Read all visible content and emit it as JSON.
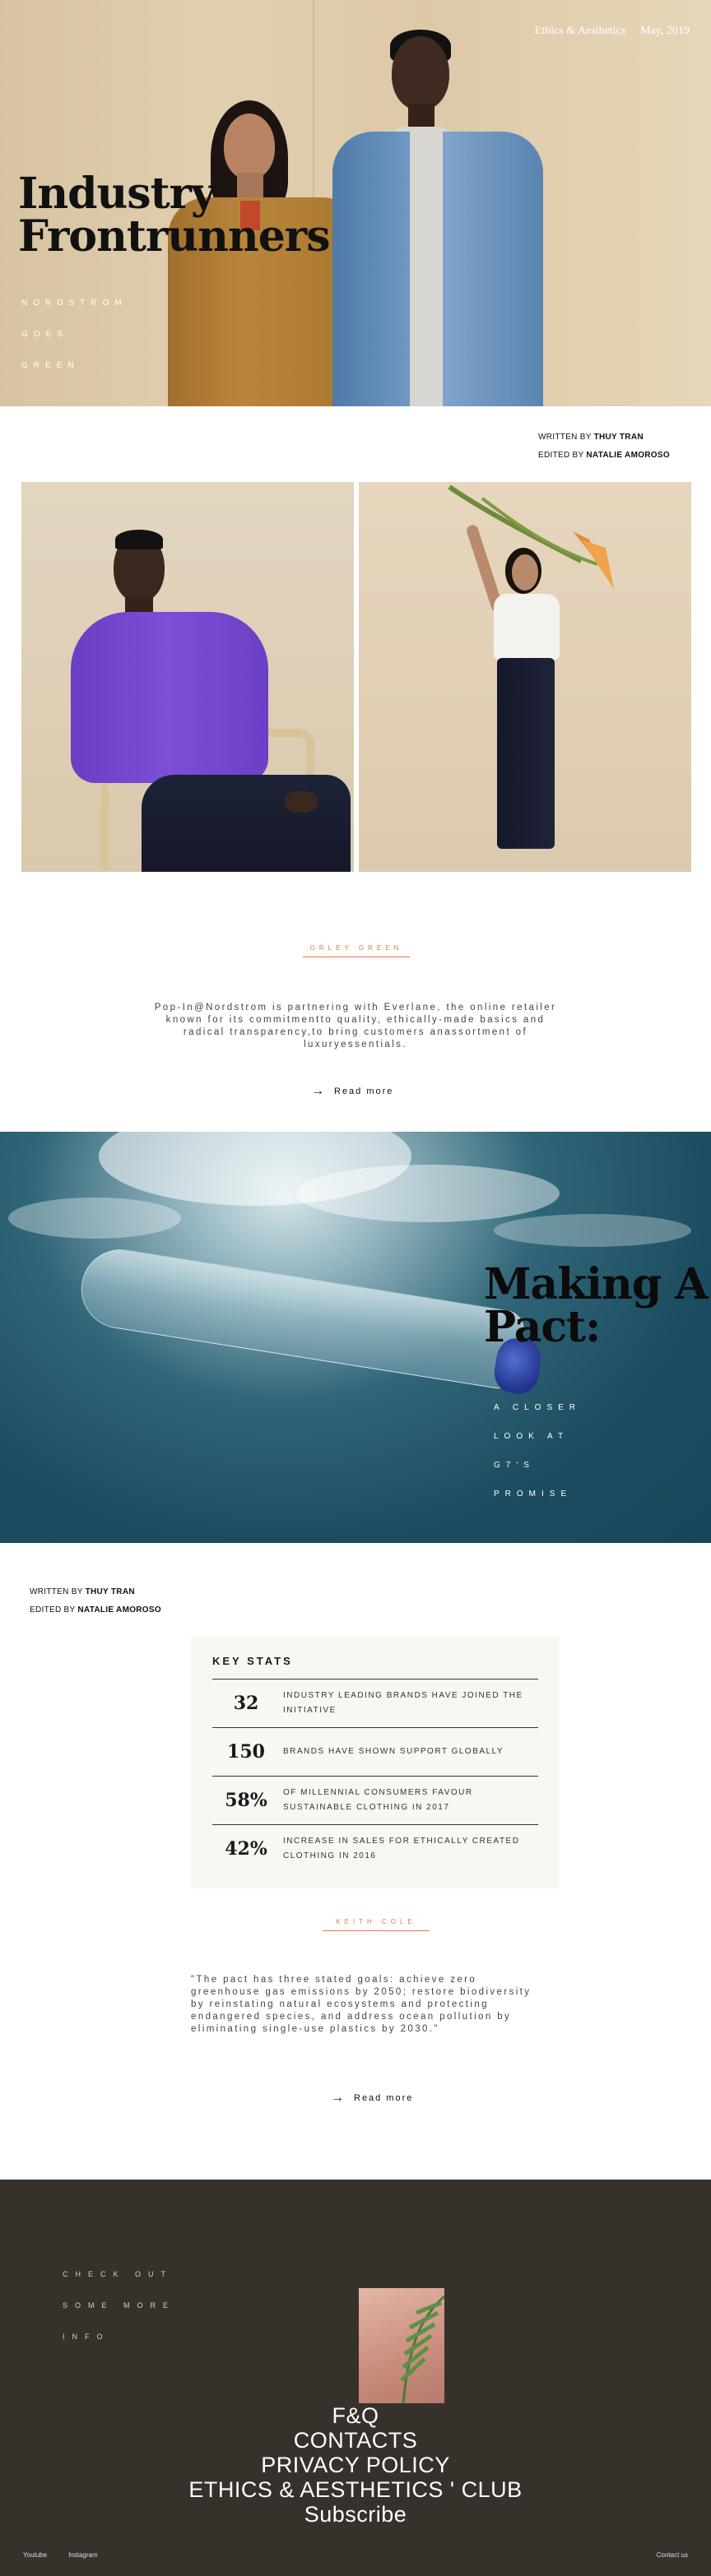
{
  "header": {
    "nav": [
      "Ethics & Aesthetics",
      "May, 2019"
    ],
    "title_lines": [
      "Industry",
      "Frontrunners"
    ],
    "subtitle_lines": [
      "NORDSTROM",
      "GOES",
      "GREEN"
    ]
  },
  "credits_1": {
    "written_label": "WRITTEN BY",
    "writer": "THUY TRAN",
    "edited_label": "EDITED BY",
    "editor": "NATALIE AMOROSO"
  },
  "section_1": {
    "label": "ORLEY GREEN",
    "blurb": "Pop-In@Nordstrom is partnering with Everlane, the online retailer known for its commitmentto quality, ethically-made basics and radical transparency,to bring customers anassortment of luxuryessentials.",
    "read_more": "Read more"
  },
  "water": {
    "title_lines": [
      "Making A",
      "Pact:"
    ],
    "subtitle_lines": [
      "A CLOSER",
      "LOOK AT",
      "G7'S",
      "PROMISE"
    ]
  },
  "credits_2": {
    "written_label": "WRITTEN BY",
    "writer": "THUY TRAN",
    "edited_label": "EDITED BY",
    "editor": "NATALIE AMOROSO"
  },
  "key_stats": {
    "title": "KEY STATS",
    "rows": [
      {
        "num": "32",
        "text": "INDUSTRY LEADING BRANDS HAVE JOINED THE INITIATIVE"
      },
      {
        "num": "150",
        "text": "BRANDS HAVE SHOWN SUPPORT GLOBALLY"
      },
      {
        "num": "58%",
        "text": "OF MILLENNIAL CONSUMERS FAVOUR SUSTAINABLE CLOTHING IN 2017"
      },
      {
        "num": "42%",
        "text": "INCREASE IN SALES FOR ETHICALLY CREATED CLOTHING IN 2016"
      }
    ]
  },
  "section_2": {
    "label": "KEITH COLE",
    "quote": "\"The pact has three stated goals: achieve zero greenhouse gas emissions by 2050; restore biodiversity by reinstating natural ecosystems and protecting endangered species, and address ocean pollution by eliminating single-use plastics by 2030.\"",
    "read_more": "Read more"
  },
  "footer": {
    "check_lines": [
      "CHECK OUT",
      "SOME MORE",
      "INFO"
    ],
    "links": [
      "F&Q",
      "CONTACTS",
      "PRIVACY POLICY",
      "ETHICS & AESTHETICS ' CLUB",
      "Subscribe"
    ],
    "social": [
      "Youtube",
      "Instagram"
    ],
    "contact": "Contact us"
  },
  "colors": {
    "accent": "#e07a4a",
    "footer_bg": "#37312c",
    "hero_bg": "#dcc7a6",
    "water": "#1d4d60"
  }
}
